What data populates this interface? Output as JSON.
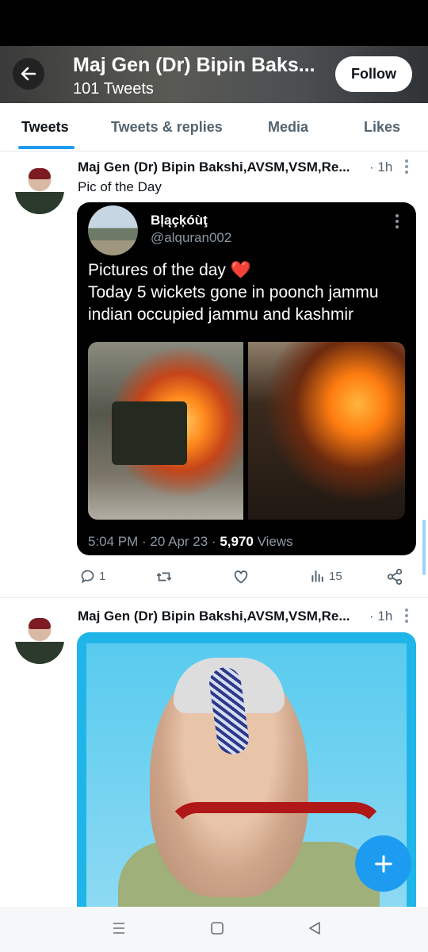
{
  "header": {
    "title": "Maj Gen (Dr) Bipin Baks...",
    "subtitle": "101 Tweets",
    "follow_label": "Follow"
  },
  "tabs": [
    {
      "label": "Tweets",
      "active": true
    },
    {
      "label": "Tweets & replies",
      "active": false
    },
    {
      "label": "Media",
      "active": false
    },
    {
      "label": "Likes",
      "active": false
    }
  ],
  "tweets": [
    {
      "author": "Maj Gen (Dr) Bipin Bakshi,AVSM,VSM,Re...",
      "time": "· 1h",
      "text": "Pic of the Day",
      "quote": {
        "name": "Bļąçķóùţ",
        "handle": "@alquran002",
        "text_line1": "Pictures of the day ❤️",
        "text_line2": "Today 5 wickets gone  in poonch jammu indian occupied jammu and kashmir",
        "meta_time": "5:04 PM · 20 Apr 23 · ",
        "meta_views_count": "5,970",
        "meta_views_label": " Views"
      },
      "actions": {
        "replies": "1",
        "retweets": "",
        "likes": "",
        "views": "15"
      }
    },
    {
      "author": "Maj Gen (Dr) Bipin Bakshi,AVSM,VSM,Re...",
      "time": "· 1h"
    }
  ],
  "colors": {
    "accent": "#1d9bf0",
    "text": "#0f1419",
    "muted": "#536471"
  },
  "icons": [
    "back-arrow-icon",
    "more-icon",
    "reply-icon",
    "retweet-icon",
    "like-icon",
    "views-icon",
    "share-icon",
    "compose-plus-icon",
    "nav-menu-icon",
    "nav-home-icon",
    "nav-back-icon"
  ]
}
